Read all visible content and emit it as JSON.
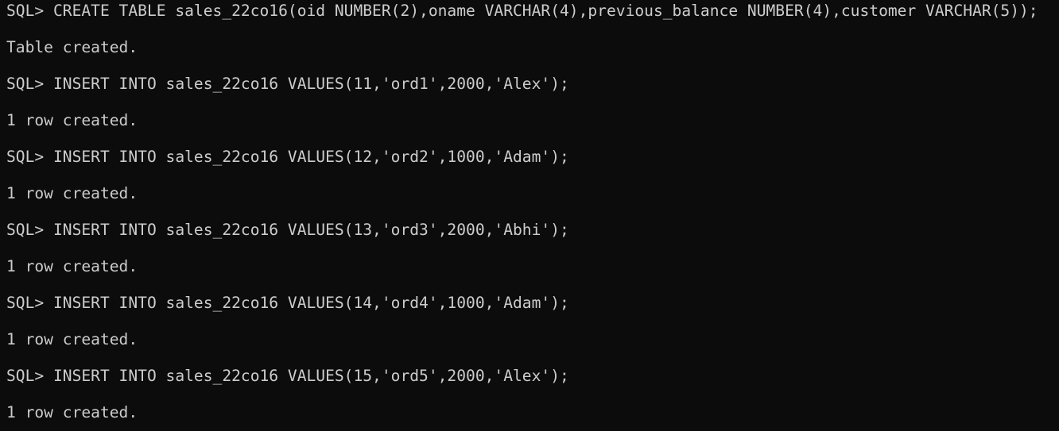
{
  "terminal": {
    "lines": [
      "SQL> CREATE TABLE sales_22co16(oid NUMBER(2),oname VARCHAR(4),previous_balance NUMBER(4),customer VARCHAR(5));",
      "Table created.",
      "SQL> INSERT INTO sales_22co16 VALUES(11,'ord1',2000,'Alex');",
      "1 row created.",
      "SQL> INSERT INTO sales_22co16 VALUES(12,'ord2',1000,'Adam');",
      "1 row created.",
      "SQL> INSERT INTO sales_22co16 VALUES(13,'ord3',2000,'Abhi');",
      "1 row created.",
      "SQL> INSERT INTO sales_22co16 VALUES(14,'ord4',1000,'Adam');",
      "1 row created.",
      "SQL> INSERT INTO sales_22co16 VALUES(15,'ord5',2000,'Alex');",
      "1 row created."
    ]
  },
  "colors": {
    "background": "#0c0c0c",
    "text": "#cccccc"
  }
}
